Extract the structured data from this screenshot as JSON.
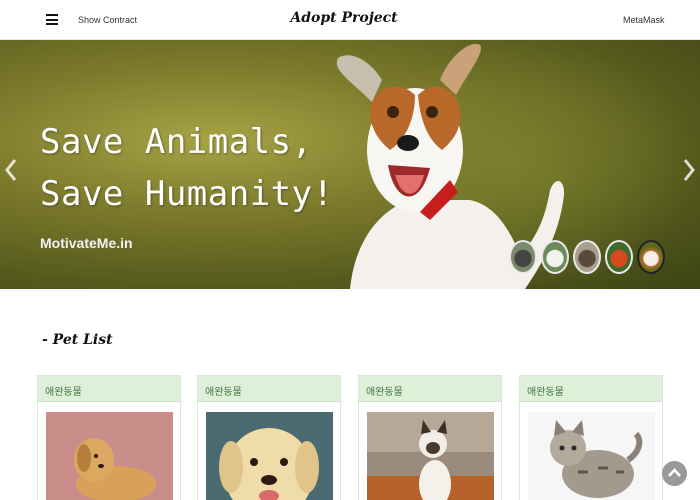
{
  "navbar": {
    "show_contract": "Show Contract",
    "brand": "Adopt Project",
    "metamask": "MetaMask"
  },
  "hero": {
    "title_line1": "Save Animals,",
    "title_line2": "Save Humanity!",
    "caption": "MotivateMe.in",
    "slide_count": 5,
    "active_slide": 5
  },
  "pet_list": {
    "title": "- Pet List",
    "cards": [
      {
        "category": "애완동물",
        "image": "golden-retriever-puppy-lying"
      },
      {
        "category": "애완동물",
        "image": "labrador-puppy-face"
      },
      {
        "category": "애완동물",
        "image": "siamese-kitten-sitting"
      },
      {
        "category": "애완동물",
        "image": "tabby-kitten-walking"
      }
    ]
  },
  "colors": {
    "card_header_bg": "#dff0d8",
    "card_header_text": "#3c763d",
    "hero_green": "#7d7a2c"
  },
  "icons": {
    "menu": "hamburger-icon",
    "prev": "chevron-left-icon",
    "next": "chevron-right-icon",
    "scroll_top": "chevron-up-icon"
  }
}
